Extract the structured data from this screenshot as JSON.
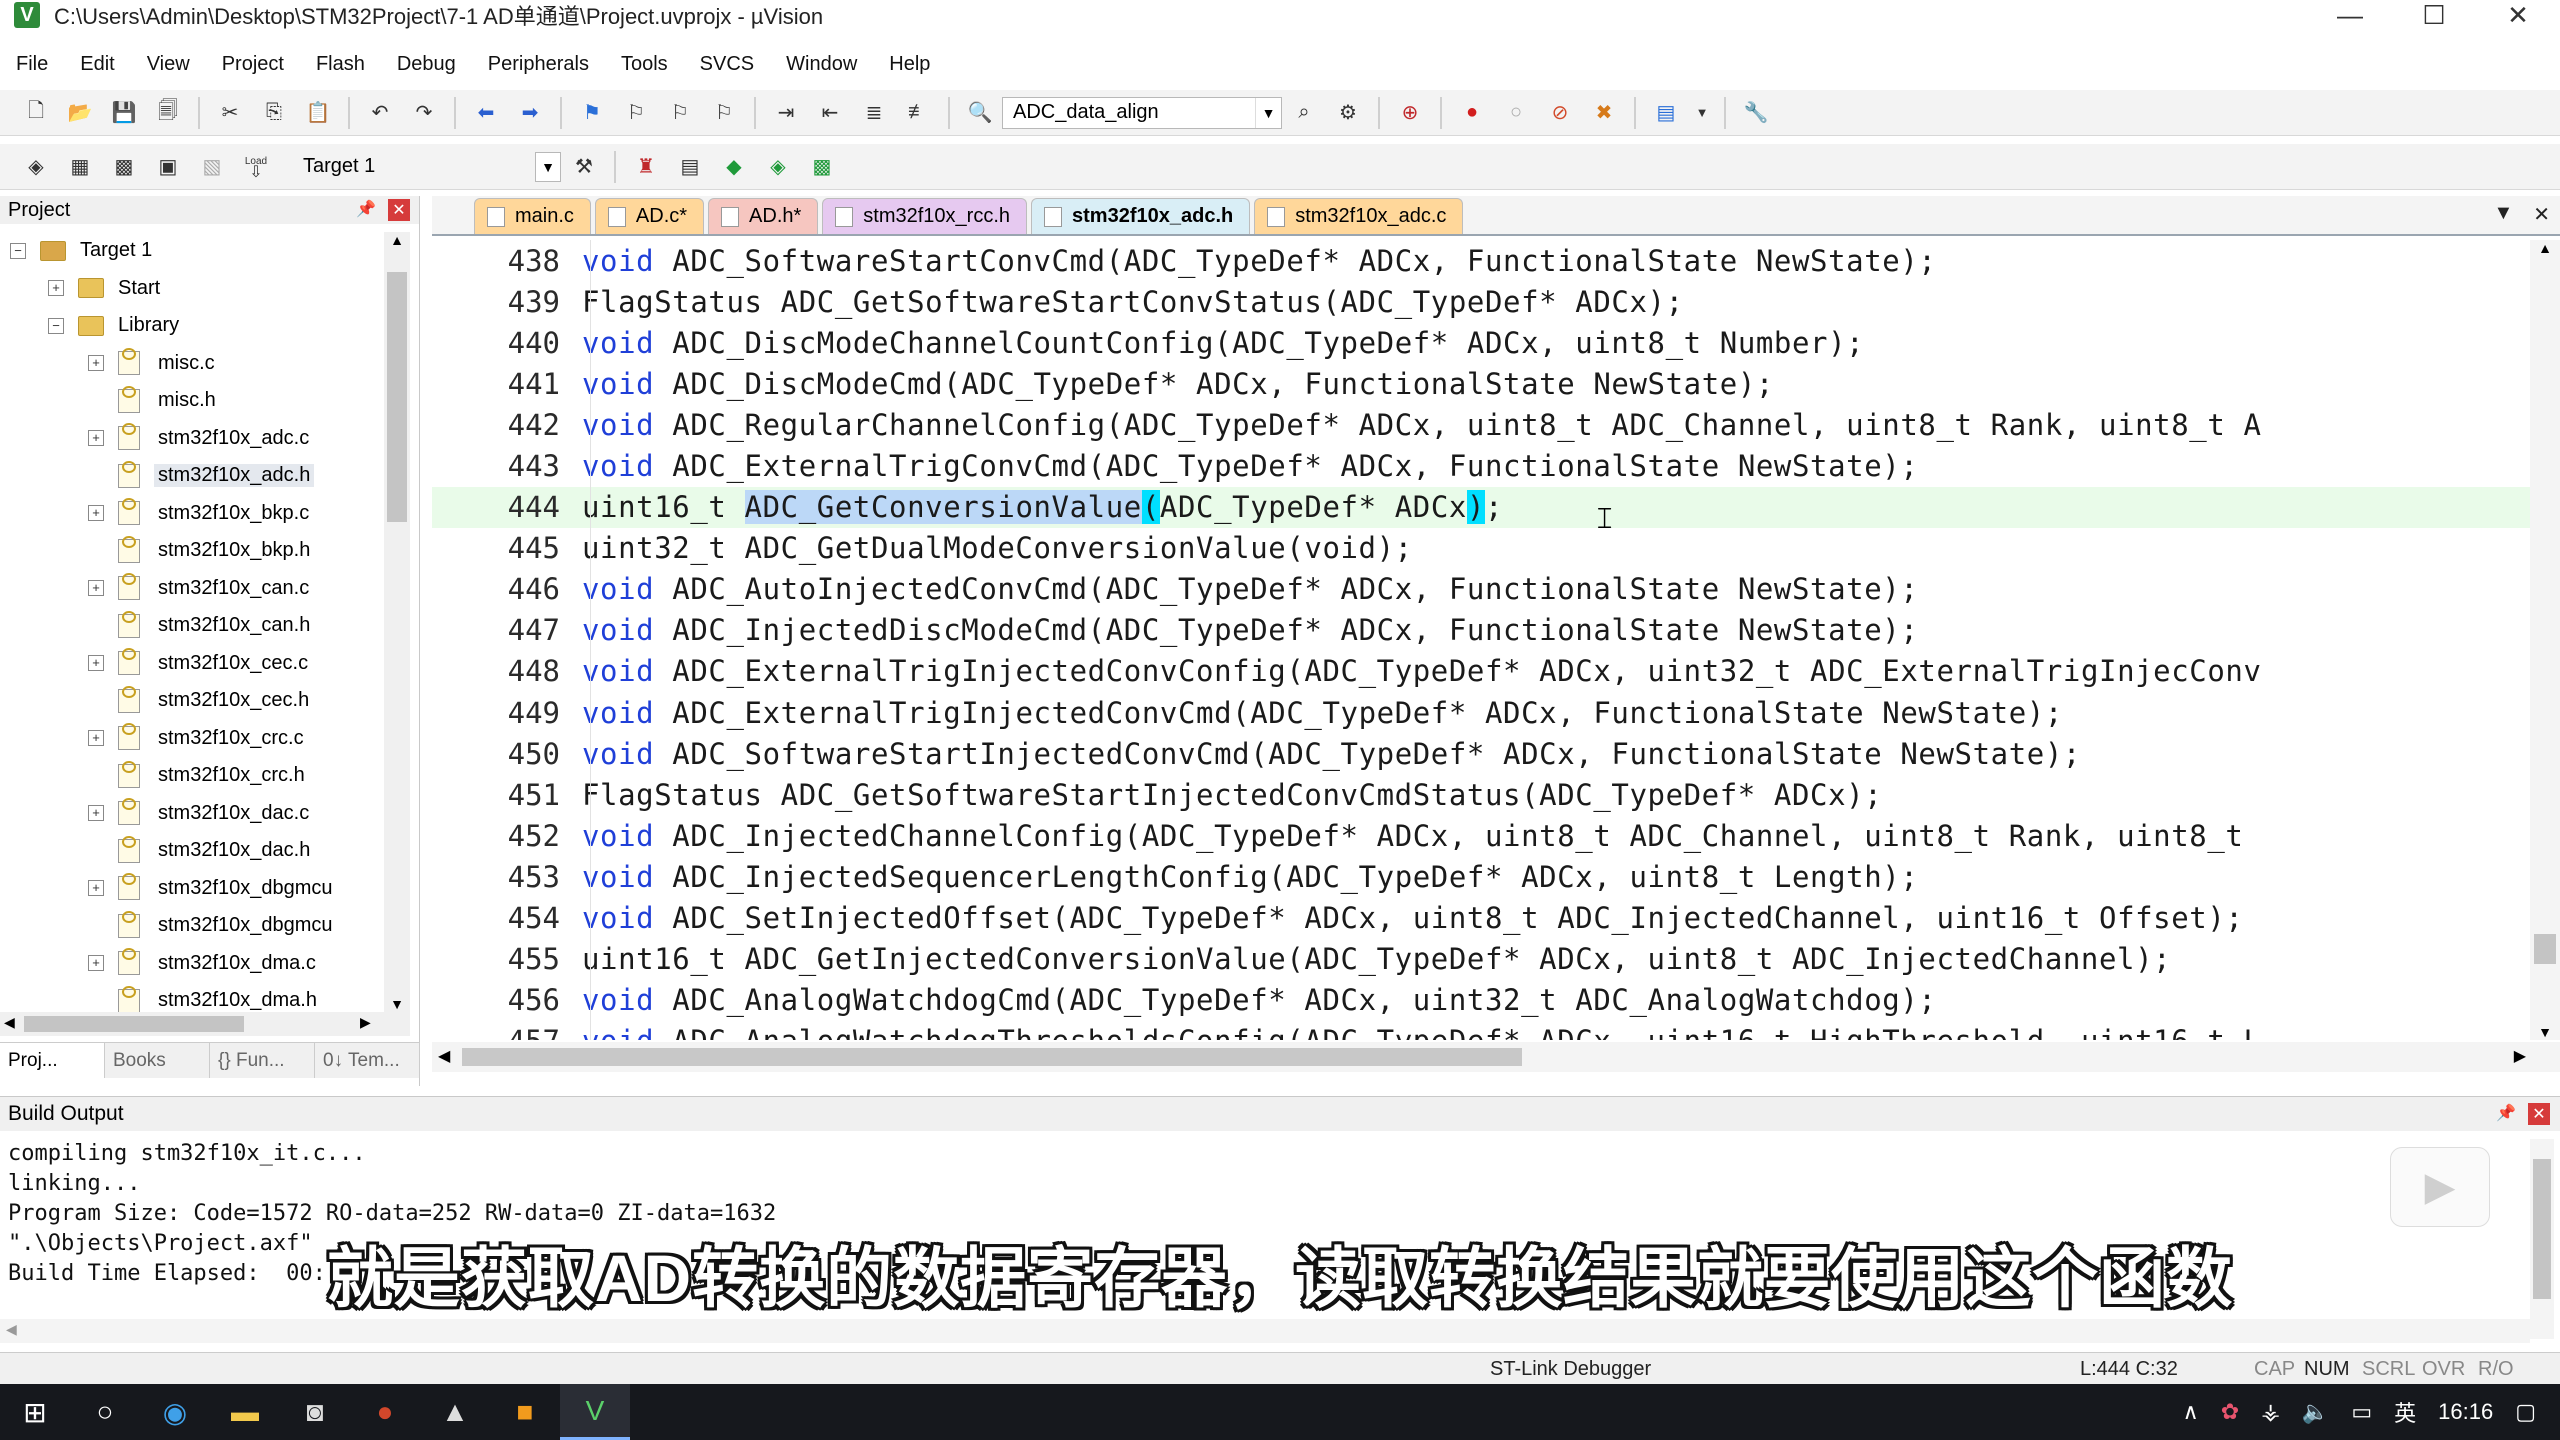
{
  "window": {
    "title": "C:\\Users\\Admin\\Desktop\\STM32Project\\7-1 AD单通道\\Project.uvprojx - µVision",
    "minimize": "—",
    "maximize": "☐",
    "close": "✕"
  },
  "menu": [
    "File",
    "Edit",
    "View",
    "Project",
    "Flash",
    "Debug",
    "Peripherals",
    "Tools",
    "SVCS",
    "Window",
    "Help"
  ],
  "toolbar1": {
    "find_value": "ADC_data_align"
  },
  "toolbar2": {
    "load_label": "Load",
    "target_value": "Target 1"
  },
  "project_panel": {
    "title": "Project",
    "tree": [
      {
        "label": "Target 1",
        "level": 1,
        "type": "target",
        "expander": "⊟"
      },
      {
        "label": "Start",
        "level": 2,
        "type": "folder",
        "expander": "⊞"
      },
      {
        "label": "Library",
        "level": 2,
        "type": "folder",
        "expander": "⊟"
      },
      {
        "label": "misc.c",
        "level": 3,
        "type": "file",
        "expander": "⊞"
      },
      {
        "label": "misc.h",
        "level": 3,
        "type": "file",
        "expander": ""
      },
      {
        "label": "stm32f10x_adc.c",
        "level": 3,
        "type": "file",
        "expander": "⊞"
      },
      {
        "label": "stm32f10x_adc.h",
        "level": 3,
        "type": "file",
        "expander": "",
        "selected": true
      },
      {
        "label": "stm32f10x_bkp.c",
        "level": 3,
        "type": "file",
        "expander": "⊞"
      },
      {
        "label": "stm32f10x_bkp.h",
        "level": 3,
        "type": "file",
        "expander": ""
      },
      {
        "label": "stm32f10x_can.c",
        "level": 3,
        "type": "file",
        "expander": "⊞"
      },
      {
        "label": "stm32f10x_can.h",
        "level": 3,
        "type": "file",
        "expander": ""
      },
      {
        "label": "stm32f10x_cec.c",
        "level": 3,
        "type": "file",
        "expander": "⊞"
      },
      {
        "label": "stm32f10x_cec.h",
        "level": 3,
        "type": "file",
        "expander": ""
      },
      {
        "label": "stm32f10x_crc.c",
        "level": 3,
        "type": "file",
        "expander": "⊞"
      },
      {
        "label": "stm32f10x_crc.h",
        "level": 3,
        "type": "file",
        "expander": ""
      },
      {
        "label": "stm32f10x_dac.c",
        "level": 3,
        "type": "file",
        "expander": "⊞"
      },
      {
        "label": "stm32f10x_dac.h",
        "level": 3,
        "type": "file",
        "expander": ""
      },
      {
        "label": "stm32f10x_dbgmcu",
        "level": 3,
        "type": "file",
        "expander": "⊞"
      },
      {
        "label": "stm32f10x_dbgmcu",
        "level": 3,
        "type": "file",
        "expander": ""
      },
      {
        "label": "stm32f10x_dma.c",
        "level": 3,
        "type": "file",
        "expander": "⊞"
      },
      {
        "label": "stm32f10x_dma.h",
        "level": 3,
        "type": "file",
        "expander": ""
      }
    ],
    "tabs": [
      "Proj...",
      "Books",
      "{} Fun...",
      "0↓ Tem..."
    ]
  },
  "editor": {
    "tabs": [
      {
        "label": "main.c",
        "style": "orange"
      },
      {
        "label": "AD.c*",
        "style": "orange"
      },
      {
        "label": "AD.h*",
        "style": "pink"
      },
      {
        "label": "stm32f10x_rcc.h",
        "style": "purple"
      },
      {
        "label": "stm32f10x_adc.h",
        "style": "active"
      },
      {
        "label": "stm32f10x_adc.c",
        "style": "orange"
      }
    ],
    "current_line": 444,
    "lines": [
      {
        "no": "438",
        "type": "void",
        "text": " ADC_SoftwareStartConvCmd(ADC_TypeDef* ADCx, FunctionalState NewState);"
      },
      {
        "no": "439",
        "type": "",
        "text": "FlagStatus ADC_GetSoftwareStartConvStatus(ADC_TypeDef* ADCx);"
      },
      {
        "no": "440",
        "type": "void",
        "text": " ADC_DiscModeChannelCountConfig(ADC_TypeDef* ADCx, uint8_t Number);"
      },
      {
        "no": "441",
        "type": "void",
        "text": " ADC_DiscModeCmd(ADC_TypeDef* ADCx, FunctionalState NewState);"
      },
      {
        "no": "442",
        "type": "void",
        "text": " ADC_RegularChannelConfig(ADC_TypeDef* ADCx, uint8_t ADC_Channel, uint8_t Rank, uint8_t A"
      },
      {
        "no": "443",
        "type": "void",
        "text": " ADC_ExternalTrigConvCmd(ADC_TypeDef* ADCx, FunctionalState NewState);"
      },
      {
        "no": "444",
        "type": "",
        "pre": "uint16_t ",
        "sel": "ADC_GetConversionValue",
        "open": "(",
        "post": "ADC_TypeDef* ADCx",
        "close": ")",
        "end": ";"
      },
      {
        "no": "445",
        "type": "",
        "text": "uint32_t ADC_GetDualModeConversionValue(void);"
      },
      {
        "no": "446",
        "type": "void",
        "text": " ADC_AutoInjectedConvCmd(ADC_TypeDef* ADCx, FunctionalState NewState);"
      },
      {
        "no": "447",
        "type": "void",
        "text": " ADC_InjectedDiscModeCmd(ADC_TypeDef* ADCx, FunctionalState NewState);"
      },
      {
        "no": "448",
        "type": "void",
        "text": " ADC_ExternalTrigInjectedConvConfig(ADC_TypeDef* ADCx, uint32_t ADC_ExternalTrigInjecConv"
      },
      {
        "no": "449",
        "type": "void",
        "text": " ADC_ExternalTrigInjectedConvCmd(ADC_TypeDef* ADCx, FunctionalState NewState);"
      },
      {
        "no": "450",
        "type": "void",
        "text": " ADC_SoftwareStartInjectedConvCmd(ADC_TypeDef* ADCx, FunctionalState NewState);"
      },
      {
        "no": "451",
        "type": "",
        "text": "FlagStatus ADC_GetSoftwareStartInjectedConvCmdStatus(ADC_TypeDef* ADCx);"
      },
      {
        "no": "452",
        "type": "void",
        "text": " ADC_InjectedChannelConfig(ADC_TypeDef* ADCx, uint8_t ADC_Channel, uint8_t Rank, uint8_t"
      },
      {
        "no": "453",
        "type": "void",
        "text": " ADC_InjectedSequencerLengthConfig(ADC_TypeDef* ADCx, uint8_t Length);"
      },
      {
        "no": "454",
        "type": "void",
        "text": " ADC_SetInjectedOffset(ADC_TypeDef* ADCx, uint8_t ADC_InjectedChannel, uint16_t Offset);"
      },
      {
        "no": "455",
        "type": "",
        "text": "uint16_t ADC_GetInjectedConversionValue(ADC_TypeDef* ADCx, uint8_t ADC_InjectedChannel);"
      },
      {
        "no": "456",
        "type": "void",
        "text": " ADC_AnalogWatchdogCmd(ADC_TypeDef* ADCx, uint32_t ADC_AnalogWatchdog);"
      },
      {
        "no": "457",
        "type": "void",
        "text": " ADC_AnalogWatchdogThresholdsConfig(ADC_TypeDef* ADCx, uint16_t HighThreshold, uint16_t L"
      }
    ]
  },
  "build_output": {
    "title": "Build Output",
    "lines": [
      "compiling stm32f10x_it.c...",
      "linking...",
      "Program Size: Code=1572 RO-data=252 RW-data=0 ZI-data=1632",
      "\".\\Objects\\Project.axf\"",
      "Build Time Elapsed:  00:"
    ]
  },
  "subtitle": "就是获取AD转换的数据寄存器，读取转换结果就要使用这个函数",
  "statusbar": {
    "debugger": "ST-Link Debugger",
    "position": "L:444 C:32",
    "caps": "CAP",
    "num": "NUM",
    "scrl": "SCRL",
    "ovr": "OVR",
    "rw": "R/O"
  },
  "taskbar": {
    "ime": "英",
    "time": "16:16"
  },
  "colors": {
    "keyword": "#1f3fd8",
    "selection": "#bcd8f7",
    "current_line": "#e9fbe9",
    "taskbar": "#16181d"
  }
}
